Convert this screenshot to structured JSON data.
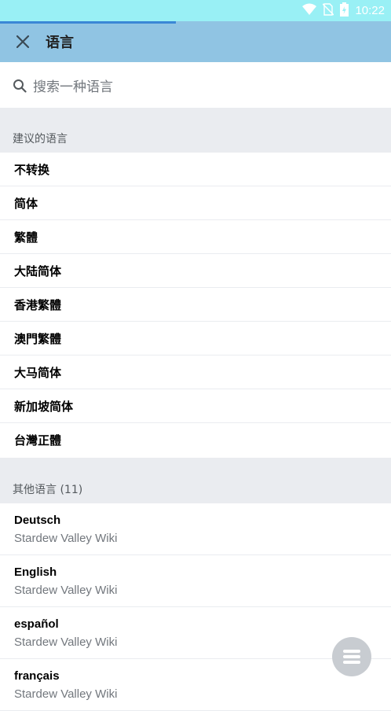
{
  "status": {
    "time": "10:22",
    "icons": [
      "wifi-icon",
      "no-sim-icon",
      "battery-charging-icon"
    ]
  },
  "header": {
    "title": "语言",
    "close_icon": "close-icon"
  },
  "search": {
    "placeholder": "搜索一种语言"
  },
  "suggested": {
    "heading": "建议的语言",
    "items": [
      "不转换",
      "简体",
      "繁體",
      "大陆简体",
      "香港繁體",
      "澳門繁體",
      "大马简体",
      "新加坡简体",
      "台灣正體"
    ]
  },
  "other": {
    "heading": "其他语言 (11)",
    "items": [
      {
        "lang": "Deutsch",
        "site": "Stardew Valley Wiki"
      },
      {
        "lang": "English",
        "site": "Stardew Valley Wiki"
      },
      {
        "lang": "español",
        "site": "Stardew Valley Wiki"
      },
      {
        "lang": "français",
        "site": "Stardew Valley Wiki"
      }
    ]
  },
  "fab": {
    "icon": "menu-icon"
  },
  "colors": {
    "statusbar": "#99f0f5",
    "header": "#90c4e3",
    "progress": "#3a87d6",
    "section": "#eaecf0"
  }
}
